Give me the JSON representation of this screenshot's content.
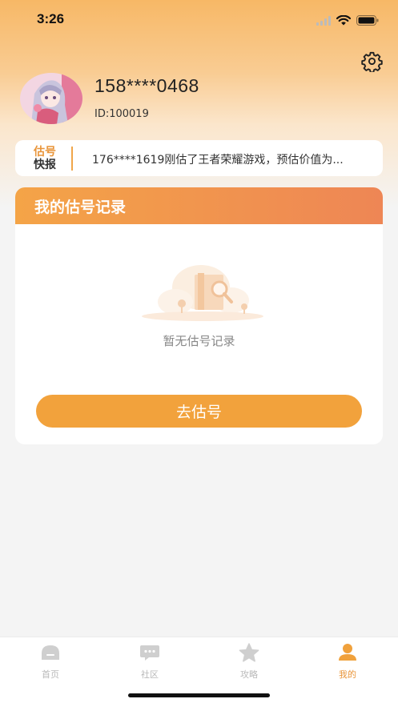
{
  "status": {
    "time": "3:26"
  },
  "profile": {
    "phone": "158****0468",
    "id": "ID:100019"
  },
  "news": {
    "logo_line1": "估号",
    "logo_line2": "快报",
    "text": "176****1619刚估了王者荣耀游戏，预估价值为..."
  },
  "records": {
    "title": "我的估号记录",
    "empty_text": "暂无估号记录",
    "button_label": "去估号"
  },
  "tabs": [
    {
      "label": "首页",
      "icon": "home-icon",
      "active": false
    },
    {
      "label": "社区",
      "icon": "chat-icon",
      "active": false
    },
    {
      "label": "攻略",
      "icon": "star-icon",
      "active": false
    },
    {
      "label": "我的",
      "icon": "person-icon",
      "active": true
    }
  ],
  "colors": {
    "accent": "#f2a23c",
    "header_gradient_start": "#f4a447",
    "header_gradient_end": "#ee8655",
    "tab_active": "#e9953a",
    "tab_inactive": "#b9b9b9"
  }
}
